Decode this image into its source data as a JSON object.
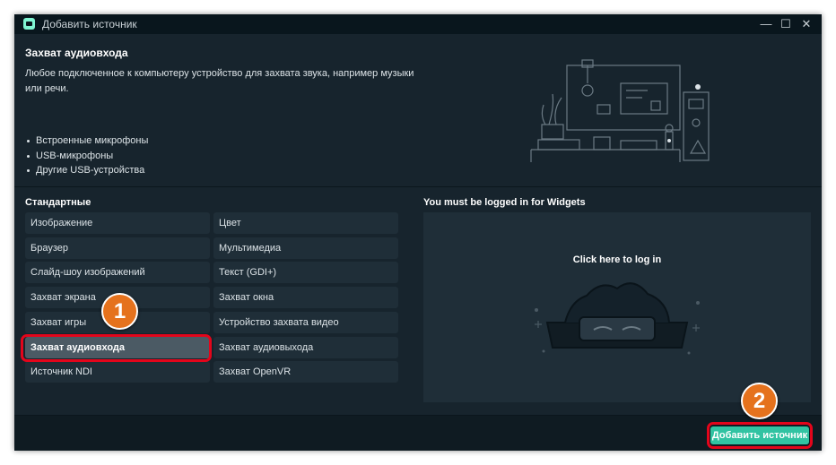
{
  "window": {
    "title": "Добавить источник",
    "controls": {
      "minimize": "—",
      "maximize": "☐",
      "close": "✕"
    }
  },
  "header": {
    "title": "Захват аудиовхода",
    "description": "Любое подключенное к компьютеру устройство для захвата звука, например музыки или речи.",
    "bullets": [
      "Встроенные микрофоны",
      "USB-микрофоны",
      "Другие USB-устройства"
    ]
  },
  "sources": {
    "section_title": "Стандартные",
    "items": [
      "Изображение",
      "Цвет",
      "Браузер",
      "Мультимедиа",
      "Слайд-шоу изображений",
      "Текст (GDI+)",
      "Захват экрана",
      "Захват окна",
      "Захват игры",
      "Устройство захвата видео",
      "Захват аудиовхода",
      "Захват аудиовыхода",
      "Источник NDI",
      "Захват OpenVR"
    ],
    "selected": "Захват аудиовхода"
  },
  "widgets": {
    "title": "You must be logged in for Widgets",
    "login_text": "Click here to log in"
  },
  "footer": {
    "add_button": "Добавить источник"
  },
  "markers": {
    "one": "1",
    "two": "2"
  },
  "colors": {
    "accent": "#31c3a2",
    "highlight": "#e3051b",
    "marker": "#e5721d",
    "background": "#17242d"
  }
}
